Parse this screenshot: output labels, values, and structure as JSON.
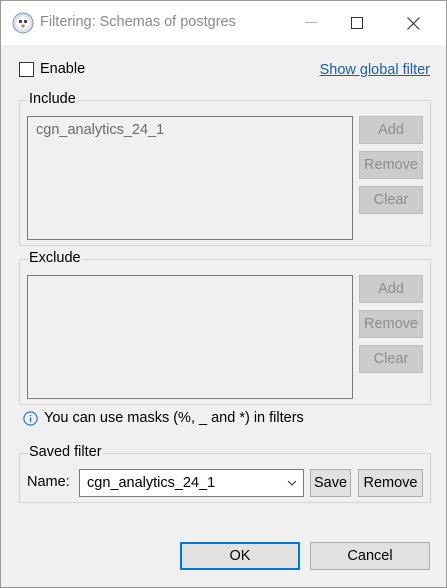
{
  "window": {
    "title": "Filtering: Schemas of postgres",
    "controls": {
      "minimize": "minimize",
      "maximize": "maximize",
      "close": "close"
    }
  },
  "enable": {
    "label": "Enable",
    "checked": false
  },
  "global_filter_link": "Show global filter",
  "include": {
    "legend": "Include",
    "items": [
      "cgn_analytics_24_1"
    ],
    "buttons": {
      "add": "Add",
      "remove": "Remove",
      "clear": "Clear"
    }
  },
  "exclude": {
    "legend": "Exclude",
    "items": [],
    "buttons": {
      "add": "Add",
      "remove": "Remove",
      "clear": "Clear"
    }
  },
  "hint": "You can use masks (%, _ and *) in filters",
  "saved_filter": {
    "legend": "Saved filter",
    "name_label": "Name:",
    "name_value": "cgn_analytics_24_1",
    "save_label": "Save",
    "remove_label": "Remove"
  },
  "footer": {
    "ok_label": "OK",
    "cancel_label": "Cancel"
  },
  "colors": {
    "link": "#1a5fa8",
    "focus_border": "#0078d7",
    "disabled_text": "#8d8d8d"
  },
  "icons": [
    "dbeaver-beaver-icon",
    "minimize-icon",
    "maximize-icon",
    "close-icon",
    "info-icon",
    "chevron-down-icon"
  ]
}
